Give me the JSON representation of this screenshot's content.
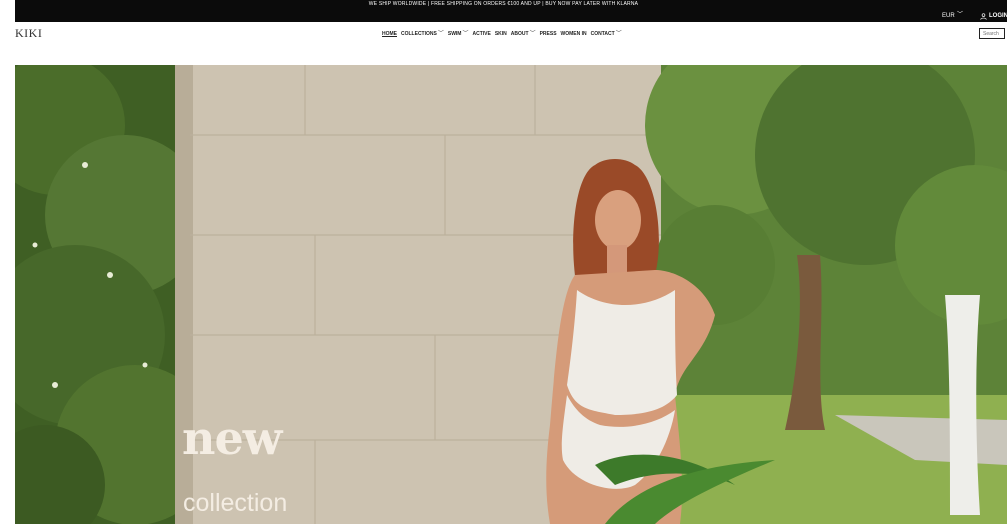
{
  "announcement": "WE SHIP WORLDWIDE | FREE SHIPPING ON ORDERS €100 AND UP | BUY NOW PAY LATER WITH KLARNA",
  "topbar": {
    "currency": "EUR",
    "login": "LOGIN"
  },
  "logo": "KIKI",
  "nav": {
    "items": [
      {
        "label": "HOME"
      },
      {
        "label": "COLLECTIONS"
      },
      {
        "label": "SWIM"
      },
      {
        "label": "ACTIVE"
      },
      {
        "label": "SKIN"
      },
      {
        "label": "ABOUT"
      },
      {
        "label": "PRESS"
      },
      {
        "label": "WOMEN IN"
      },
      {
        "label": "CONTACT"
      }
    ]
  },
  "search": {
    "placeholder": "Search"
  },
  "hero": {
    "title": "new",
    "subtitle": "collection"
  },
  "colors": {
    "topbar": "#0b0b0b",
    "hero_text": "#f4ede3",
    "foliage": "#4f6e2e"
  }
}
